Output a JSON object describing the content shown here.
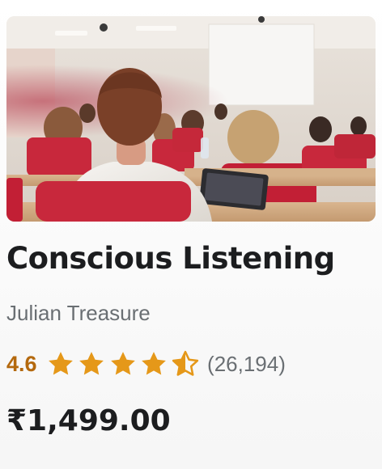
{
  "course": {
    "title": "Conscious Listening",
    "instructor": "Julian Treasure",
    "rating_value": "4.6",
    "rating": 4.6,
    "rating_count": "(26,194)",
    "price": "₹1,499.00"
  },
  "thumbnail": {
    "subject": "classroom-lecture-photo"
  },
  "colors": {
    "title": "#1c1d1f",
    "muted": "#6a6f73",
    "rating_orange": "#b4690e",
    "star_fill": "#e59819",
    "seat_red": "#c8283c"
  }
}
